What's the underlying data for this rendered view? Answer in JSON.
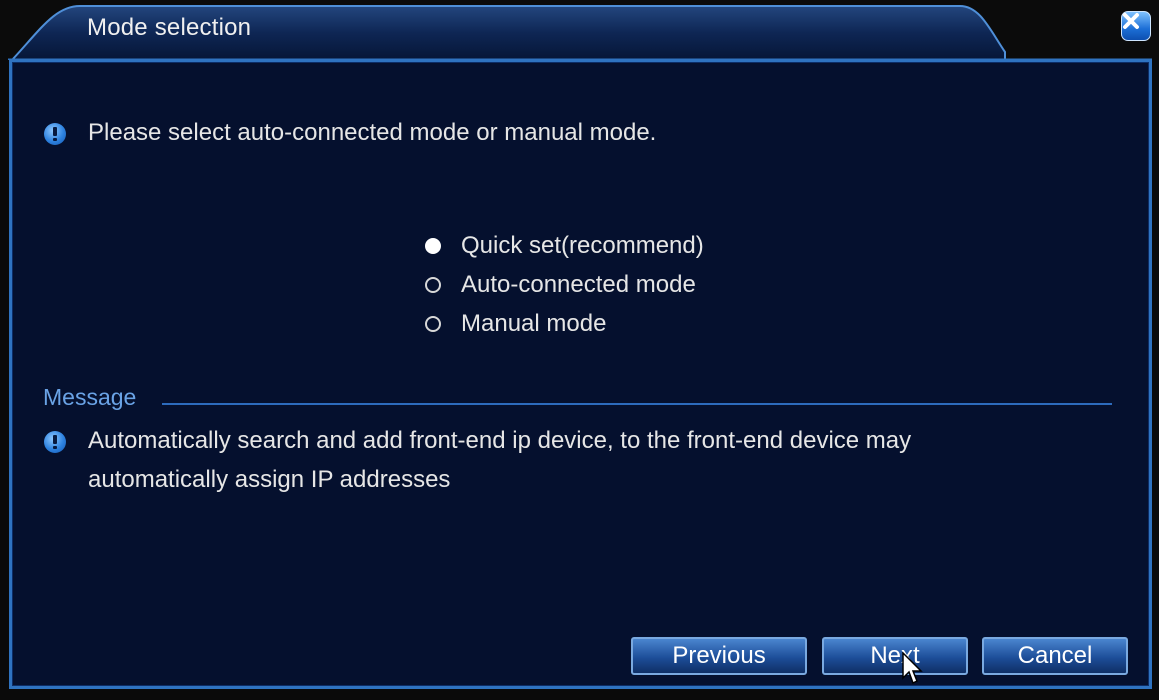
{
  "window": {
    "title": "Mode selection"
  },
  "prompt": {
    "text": "Please select auto-connected mode or manual mode."
  },
  "modes": {
    "selected_index": 0,
    "options": [
      {
        "label": "Quick set(recommend)"
      },
      {
        "label": "Auto-connected mode"
      },
      {
        "label": "Manual mode"
      }
    ]
  },
  "message": {
    "section_label": "Message",
    "line1": "Automatically search and add front-end ip device, to the front-end device may",
    "line2": "automatically assign IP addresses"
  },
  "buttons": {
    "previous": "Previous",
    "next": "Next",
    "cancel": "Cancel"
  },
  "icons": {
    "close": "close-icon",
    "info": "info-icon",
    "cursor": "mouse-cursor-icon"
  },
  "colors": {
    "panel_bg": "#05102e",
    "accent": "#2f73c0",
    "message_label": "#6aa3e6"
  }
}
